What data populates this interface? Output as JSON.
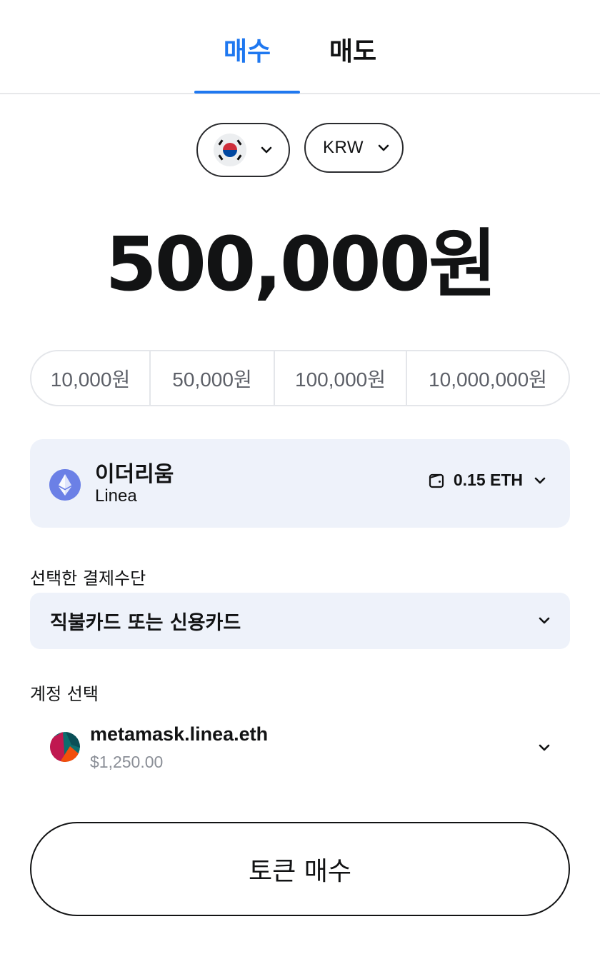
{
  "tabs": [
    {
      "label": "매수",
      "active": true
    },
    {
      "label": "매도",
      "active": false
    }
  ],
  "region": {
    "flag_icon": "south-korea-flag-icon",
    "dropdown_icon": "chevron-down-icon"
  },
  "currency": {
    "code": "KRW",
    "dropdown_icon": "chevron-down-icon"
  },
  "amount": {
    "display": "500,000원"
  },
  "quick_amounts": [
    "10,000원",
    "50,000원",
    "100,000원",
    "10,000,000원"
  ],
  "token": {
    "name": "이더리움",
    "network": "Linea",
    "icon": "ethereum-icon",
    "balance": "0.15 ETH",
    "balance_icon": "wallet-icon"
  },
  "payment": {
    "label": "선택한 결제수단",
    "value": "직불카드 또는 신용카드"
  },
  "account": {
    "label": "계정 선택",
    "name": "metamask.linea.eth",
    "balance": "$1,250.00"
  },
  "submit": {
    "label": "토큰 매수"
  },
  "colors": {
    "accent": "#1f78f0",
    "card_bg": "#eef2fa",
    "text": "#121314",
    "muted": "#8b8f97",
    "eth": "#6b80e6"
  }
}
